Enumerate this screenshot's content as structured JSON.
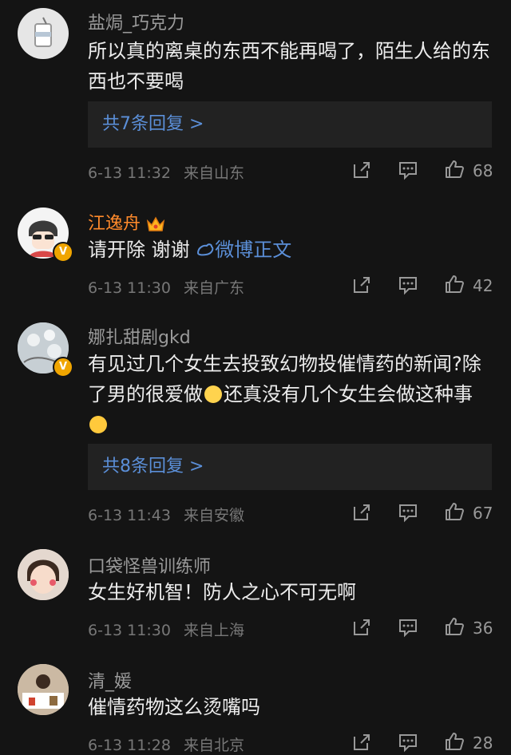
{
  "comments": [
    {
      "username": "盐焗_巧克力",
      "text": "所以真的离桌的东西不能再喝了，陌生人给的东西也不要喝",
      "replies_label": "共7条回复 >",
      "time": "6-13 11:32",
      "location": "来自山东",
      "likes": "68"
    },
    {
      "username": "江逸舟",
      "text": "请开除 谢谢",
      "link_text": "微博正文",
      "time": "6-13 11:30",
      "location": "来自广东",
      "likes": "42"
    },
    {
      "username": "娜扎甜剧gkd",
      "text_part1": "有见过几个女生去投致幻物投催情药的新闻?除了男的很爱做",
      "text_part2": "还真没有几个女生会做这种事",
      "replies_label": "共8条回复 >",
      "time": "6-13 11:43",
      "location": "来自安徽",
      "likes": "67"
    },
    {
      "username": "口袋怪兽训练师",
      "text": "女生好机智！防人之心不可无啊",
      "time": "6-13 11:30",
      "location": "来自上海",
      "likes": "36"
    },
    {
      "username": "清_媛",
      "text": "催情药物这么烫嘴吗",
      "time": "6-13 11:28",
      "location": "来自北京",
      "likes": "28"
    }
  ],
  "icons": {
    "share": "share-icon",
    "comment": "comment-icon",
    "like": "thumbs-up-icon",
    "verified": "verified-badge-icon",
    "crown": "crown-icon"
  },
  "colors": {
    "background": "#141414",
    "username_vip": "#ff8a2b",
    "link": "#5b8fd8",
    "verified": "#f0a500"
  }
}
